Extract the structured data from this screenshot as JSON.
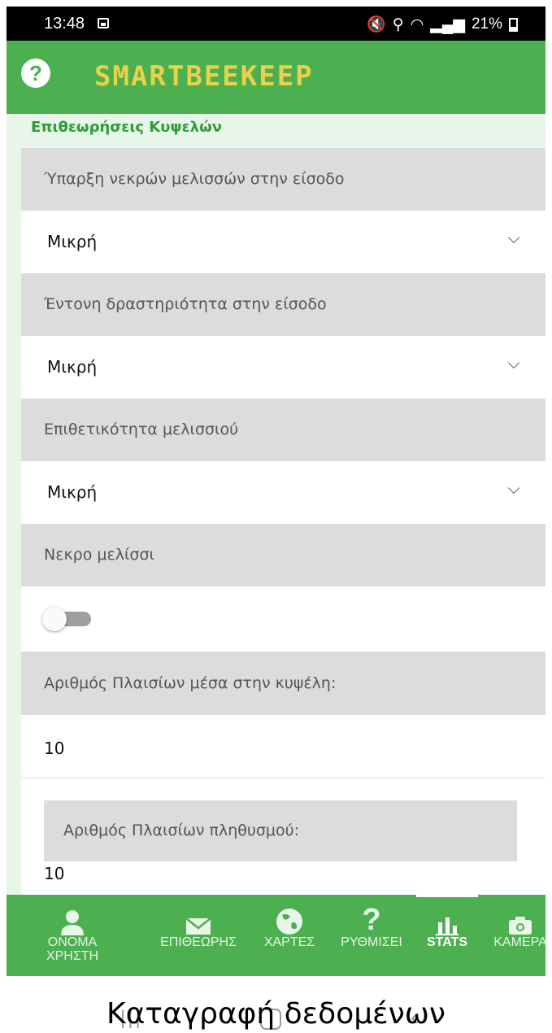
{
  "status_bar": {
    "time": "13:48",
    "battery": "21%"
  },
  "app_bar": {
    "brand": "SMARTBEEKEEP",
    "help_glyph": "?"
  },
  "section": {
    "title": "Επιθεωρήσεις Κυψελών"
  },
  "form": {
    "dead_bees_label": "Ύπαρξη νεκρών μελισσών στην είσοδο",
    "dead_bees_value": "Μικρή",
    "activity_label": "Έντονη δραστηριότητα στην είσοδο",
    "activity_value": "Μικρή",
    "aggressiveness_label": "Επιθετικότητα μελισσιού",
    "aggressiveness_value": "Μικρή",
    "dead_colony_label": "Νεκρο μελίσσι",
    "dead_colony_on": false,
    "frames_label": "Αριθμός Πλαισίων μέσα στην κυψέλη:",
    "frames_value": "10",
    "population_frames_label": "Αριθμός Πλαισίων πληθυσμού:",
    "population_frames_value": "10"
  },
  "bottom_nav": {
    "items": [
      {
        "label": "ΟΝΟΜΑ ΧΡΗΣΤΗ",
        "icon": "person-icon"
      },
      {
        "label": "ΕΠΙΘΕΩΡΗΣ",
        "icon": "mail-icon"
      },
      {
        "label": "ΧΑΡΤΕΣ",
        "icon": "globe-icon"
      },
      {
        "label": "ΡΥΘΜΙΣΕΙ",
        "icon": "question-icon"
      },
      {
        "label": "STATS",
        "icon": "bar-chart-icon"
      },
      {
        "label": "ΚΑΜΕΡΑ",
        "icon": "camera-icon"
      }
    ],
    "active": "STATS"
  },
  "caption": "Καταγραφή δεδομένων",
  "colors": {
    "primary": "#4caf50",
    "accent": "#2e9d3a",
    "brand": "#e8d24a",
    "label_bg": "#dcdcdc"
  }
}
